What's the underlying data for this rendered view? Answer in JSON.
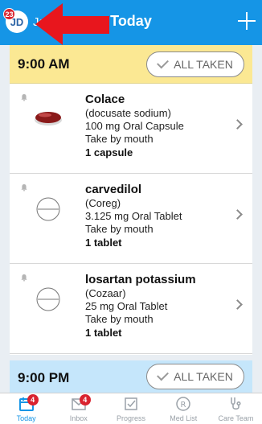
{
  "header": {
    "avatar_initials": "JD",
    "avatar_badge": "23",
    "user_name": "Ja",
    "title": "Today",
    "accent": "#1595e6"
  },
  "am_section": {
    "time": "9:00 AM",
    "all_taken_label": "ALL TAKEN",
    "bg": "#fbe893",
    "meds": [
      {
        "name": "Colace",
        "detail1": "(docusate sodium)",
        "detail2": "100 mg Oral Capsule",
        "detail3": "Take by mouth",
        "dose": "1 capsule",
        "pill_icon": "red-capsule-icon"
      },
      {
        "name": "carvedilol",
        "detail1": "(Coreg)",
        "detail2": "3.125 mg Oral Tablet",
        "detail3": "Take by mouth",
        "dose": "1 tablet",
        "pill_icon": "white-tablet-icon"
      },
      {
        "name": "losartan potassium",
        "detail1": "(Cozaar)",
        "detail2": "25 mg Oral Tablet",
        "detail3": "Take by mouth",
        "dose": "1 tablet",
        "pill_icon": "white-tablet-icon"
      }
    ]
  },
  "pm_section": {
    "time": "9:00 PM",
    "all_taken_label": "ALL TAKEN",
    "bg": "#c5e6fb"
  },
  "tabs": [
    {
      "label": "Today",
      "icon": "calendar-icon",
      "badge": "4",
      "active": true
    },
    {
      "label": "Inbox",
      "icon": "inbox-icon",
      "badge": "4",
      "active": false
    },
    {
      "label": "Progress",
      "icon": "checkbox-icon",
      "badge": "",
      "active": false
    },
    {
      "label": "Med List",
      "icon": "prescription-icon",
      "badge": "",
      "active": false
    },
    {
      "label": "Care Team",
      "icon": "stethoscope-icon",
      "badge": "",
      "active": false
    }
  ]
}
